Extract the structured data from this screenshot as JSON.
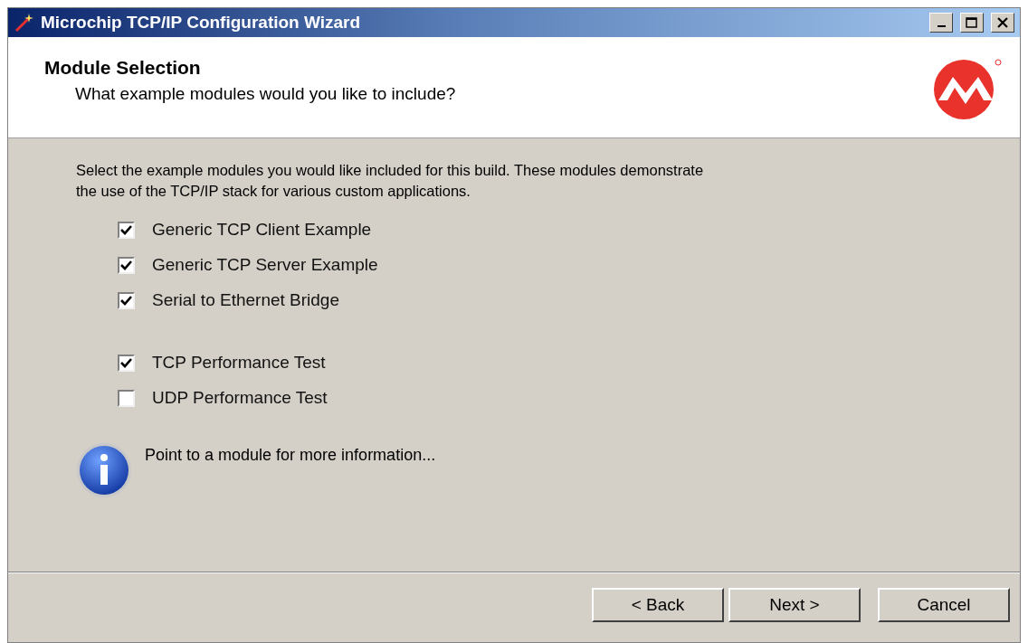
{
  "window": {
    "title": "Microchip TCP/IP Configuration Wizard"
  },
  "header": {
    "title": "Module Selection",
    "subtitle": "What example modules would you like to include?"
  },
  "intro": "Select the example modules you would like included for this build.  These modules demonstrate the use of the TCP/IP stack for various custom applications.",
  "module_groups": [
    {
      "items": [
        {
          "label": "Generic TCP Client Example",
          "checked": true
        },
        {
          "label": "Generic TCP Server Example",
          "checked": true
        },
        {
          "label": "Serial to Ethernet Bridge",
          "checked": true
        }
      ]
    },
    {
      "items": [
        {
          "label": "TCP Performance Test",
          "checked": true
        },
        {
          "label": "UDP Performance Test",
          "checked": false
        }
      ]
    }
  ],
  "info": "Point to a module for more information...",
  "buttons": [
    "< Back",
    "Next >",
    "Cancel"
  ]
}
